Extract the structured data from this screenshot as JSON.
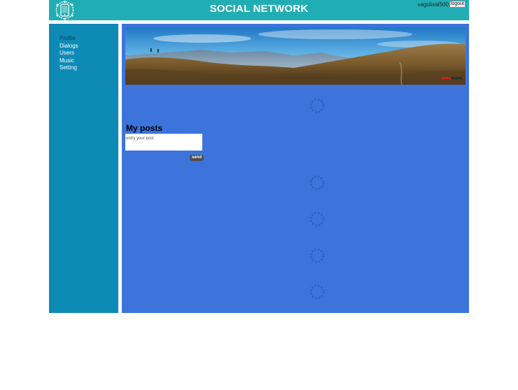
{
  "header": {
    "title": "SOCIAL NETWORK",
    "username": "vagulisal500",
    "logout_label": "logout"
  },
  "sidebar": {
    "items": [
      {
        "label": "Profile",
        "active": true
      },
      {
        "label": "Dialogs",
        "active": false
      },
      {
        "label": "Users",
        "active": false
      },
      {
        "label": "Music",
        "active": false
      },
      {
        "label": "Setting",
        "active": false
      }
    ]
  },
  "profile": {
    "banner_icon": "mountain-panorama",
    "loading_icon": "spinner-icon"
  },
  "posts": {
    "title": "My posts",
    "input_placeholder": "entry your post",
    "input_value": "",
    "send_label": "send"
  },
  "colors": {
    "header_bg": "#20aeb4",
    "sidebar_bg": "#0e8ab6",
    "content_bg": "#3c74dc",
    "active_nav": "#0b3d58"
  }
}
